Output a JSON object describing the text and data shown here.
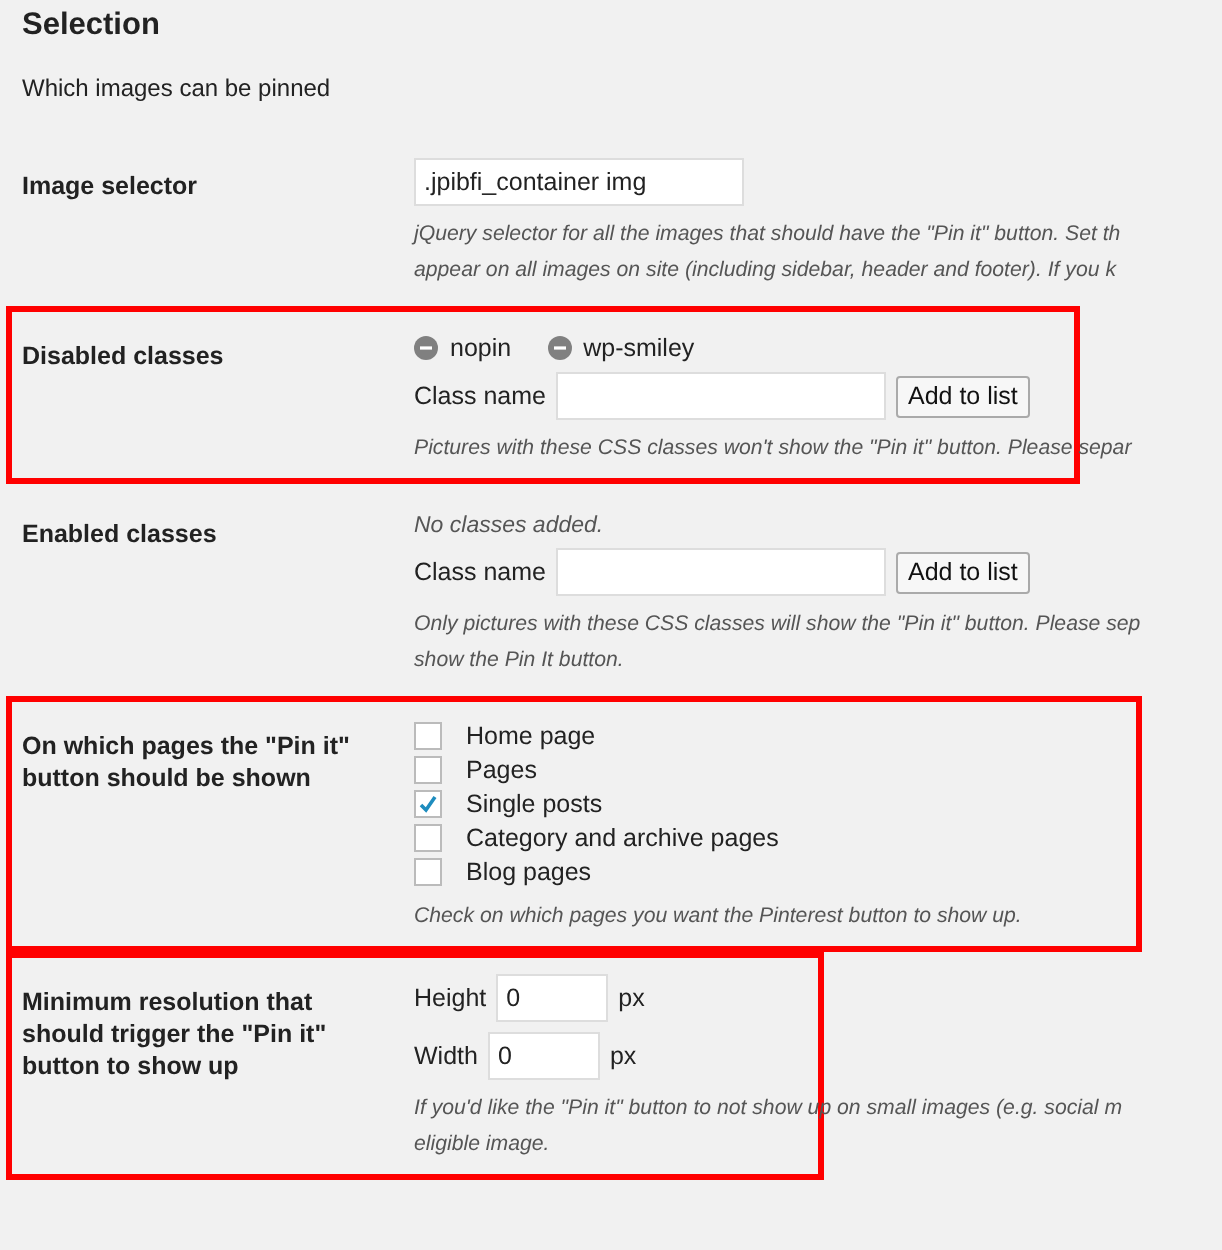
{
  "section": {
    "title": "Selection",
    "subtitle": "Which images can be pinned"
  },
  "rows": [
    {
      "kind": "text",
      "label": "Image selector",
      "highlighted": false,
      "value": ".jpibfi_container img",
      "description": [
        "jQuery selector for all the images that should have the \"Pin it\" button. Set th",
        "appear on all images on site (including sidebar, header and footer). If you k"
      ]
    },
    {
      "kind": "classes",
      "label": "Disabled classes",
      "highlighted": true,
      "tags": [
        "nopin",
        "wp-smiley"
      ],
      "field_label": "Class name",
      "button": "Add to list",
      "description": [
        "Pictures with these CSS classes won't show the \"Pin it\" button. Please separ"
      ]
    },
    {
      "kind": "classes",
      "label": "Enabled classes",
      "highlighted": false,
      "empty_note": "No classes added.",
      "field_label": "Class name",
      "button": "Add to list",
      "description": [
        "Only pictures with these CSS classes will show the \"Pin it\" button. Please sep",
        "show the Pin It button."
      ]
    },
    {
      "kind": "checks",
      "label": "On which pages the \"Pin it\" button should be shown",
      "highlighted": true,
      "options": [
        {
          "label": "Home page",
          "checked": false
        },
        {
          "label": "Pages",
          "checked": false
        },
        {
          "label": "Single posts",
          "checked": true
        },
        {
          "label": "Category and archive pages",
          "checked": false
        },
        {
          "label": "Blog pages",
          "checked": false
        }
      ],
      "description": [
        "Check on which pages you want the Pinterest button to show up."
      ]
    },
    {
      "kind": "size",
      "label": "Minimum resolution that should trigger the \"Pin it\" button to show up",
      "highlighted": true,
      "fields": [
        {
          "label": "Height",
          "value": "0",
          "unit": "px"
        },
        {
          "label": "Width",
          "value": "0",
          "unit": "px"
        }
      ],
      "description": [
        "If you'd like the \"Pin it\" button to not show up on small images (e.g. social m",
        "eligible image."
      ]
    }
  ]
}
